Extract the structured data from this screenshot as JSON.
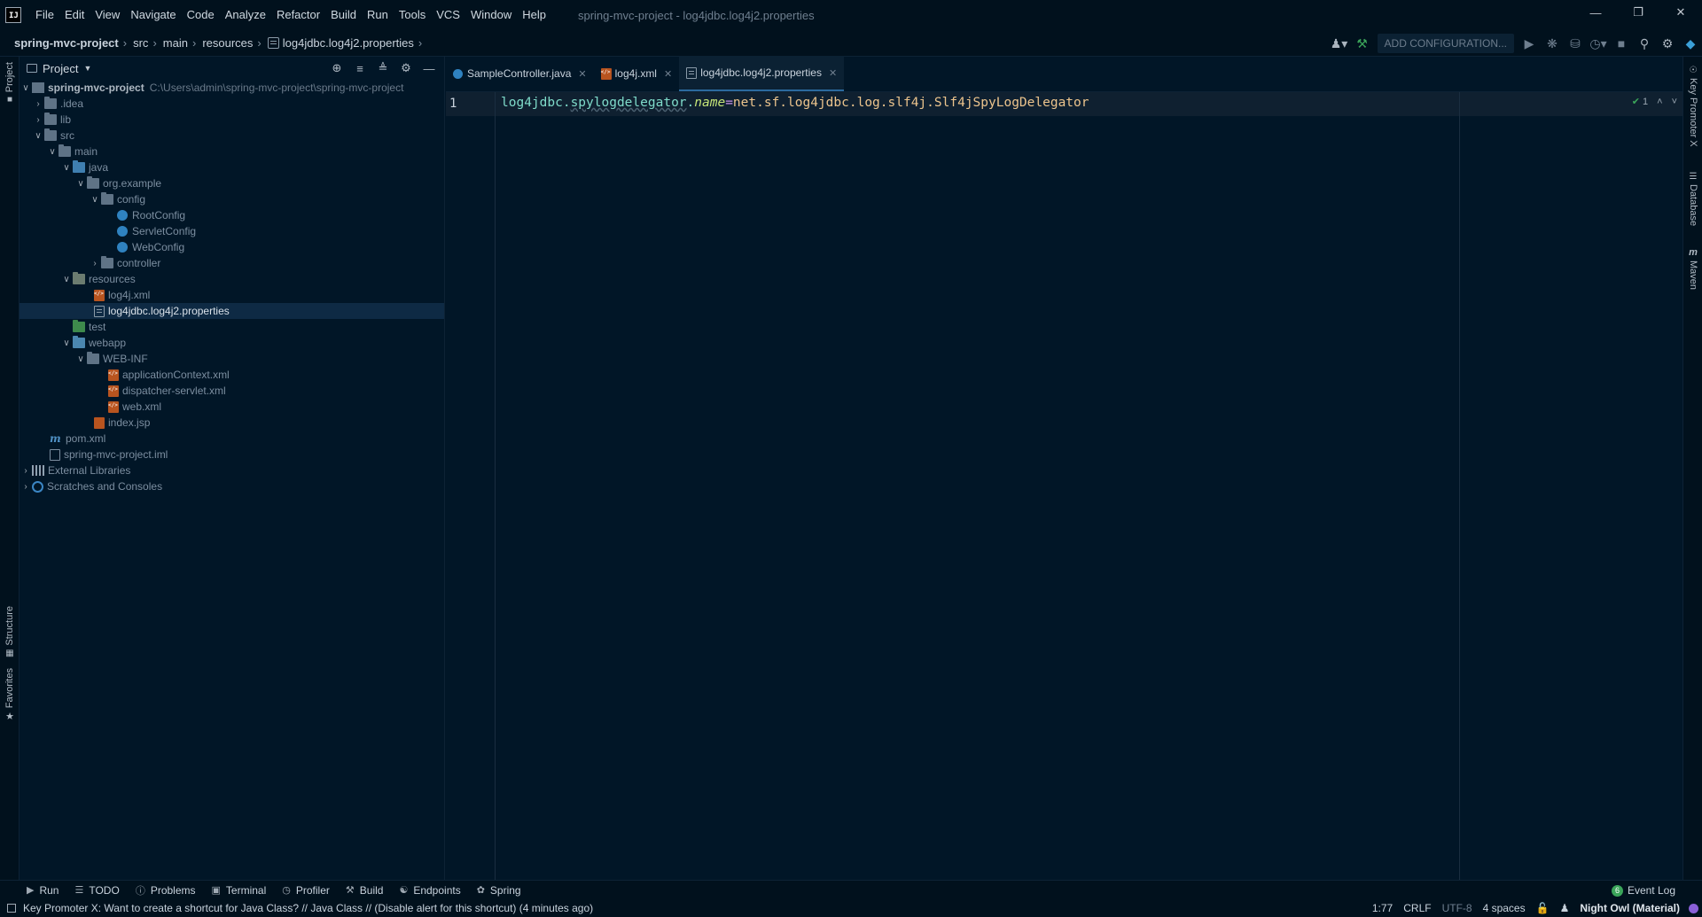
{
  "menubar": {
    "items": [
      "File",
      "Edit",
      "View",
      "Navigate",
      "Code",
      "Analyze",
      "Refactor",
      "Build",
      "Run",
      "Tools",
      "VCS",
      "Window",
      "Help"
    ],
    "window_title": "spring-mvc-project - log4jdbc.log4j2.properties"
  },
  "breadcrumb": {
    "project": "spring-mvc-project",
    "src": "src",
    "main": "main",
    "resources": "resources",
    "file": "log4jdbc.log4j2.properties"
  },
  "toolbar": {
    "add_configuration": "ADD CONFIGURATION..."
  },
  "project_panel": {
    "title": "Project",
    "tree": [
      {
        "label": "spring-mvc-project",
        "path": "C:\\Users\\admin\\spring-mvc-project\\spring-mvc-project"
      },
      {
        "label": ".idea"
      },
      {
        "label": "lib"
      },
      {
        "label": "src"
      },
      {
        "label": "main"
      },
      {
        "label": "java"
      },
      {
        "label": "org.example"
      },
      {
        "label": "config"
      },
      {
        "label": "RootConfig"
      },
      {
        "label": "ServletConfig"
      },
      {
        "label": "WebConfig"
      },
      {
        "label": "controller"
      },
      {
        "label": "resources"
      },
      {
        "label": "log4j.xml"
      },
      {
        "label": "log4jdbc.log4j2.properties"
      },
      {
        "label": "test"
      },
      {
        "label": "webapp"
      },
      {
        "label": "WEB-INF"
      },
      {
        "label": "applicationContext.xml"
      },
      {
        "label": "dispatcher-servlet.xml"
      },
      {
        "label": "web.xml"
      },
      {
        "label": "index.jsp"
      },
      {
        "label": "pom.xml"
      },
      {
        "label": "spring-mvc-project.iml"
      },
      {
        "label": "External Libraries"
      },
      {
        "label": "Scratches and Consoles"
      }
    ]
  },
  "editor": {
    "tabs": [
      {
        "label": "SampleController.java"
      },
      {
        "label": "log4j.xml"
      },
      {
        "label": "log4jdbc.log4j2.properties"
      }
    ],
    "line_number": "1",
    "code": {
      "key_prefix": "log4jdbc.",
      "key_mid": "spylogdelegator",
      "key_dot": ".",
      "key_suffix": "name",
      "eq": "=",
      "value": "net.sf.log4jdbc.log.slf4j.Slf4jSpyLogDelegator"
    },
    "inspection_count": "1"
  },
  "left_strip": {
    "project": "Project",
    "structure": "Structure",
    "favorites": "Favorites"
  },
  "right_strip": {
    "key_promoter": "Key Promoter X",
    "database": "Database",
    "maven": "Maven"
  },
  "bottom_tools": {
    "run": "Run",
    "todo": "TODO",
    "problems": "Problems",
    "terminal": "Terminal",
    "profiler": "Profiler",
    "build": "Build",
    "endpoints": "Endpoints",
    "spring": "Spring",
    "event_log": "Event Log",
    "event_count": "6"
  },
  "statusbar": {
    "message": "Key Promoter X: Want to create a shortcut for Java Class? // Java Class // (Disable alert for this shortcut) (4 minutes ago)",
    "position": "1:77",
    "line_sep": "CRLF",
    "encoding": "UTF-8",
    "indent": "4 spaces",
    "theme": "Night Owl (Material)"
  }
}
